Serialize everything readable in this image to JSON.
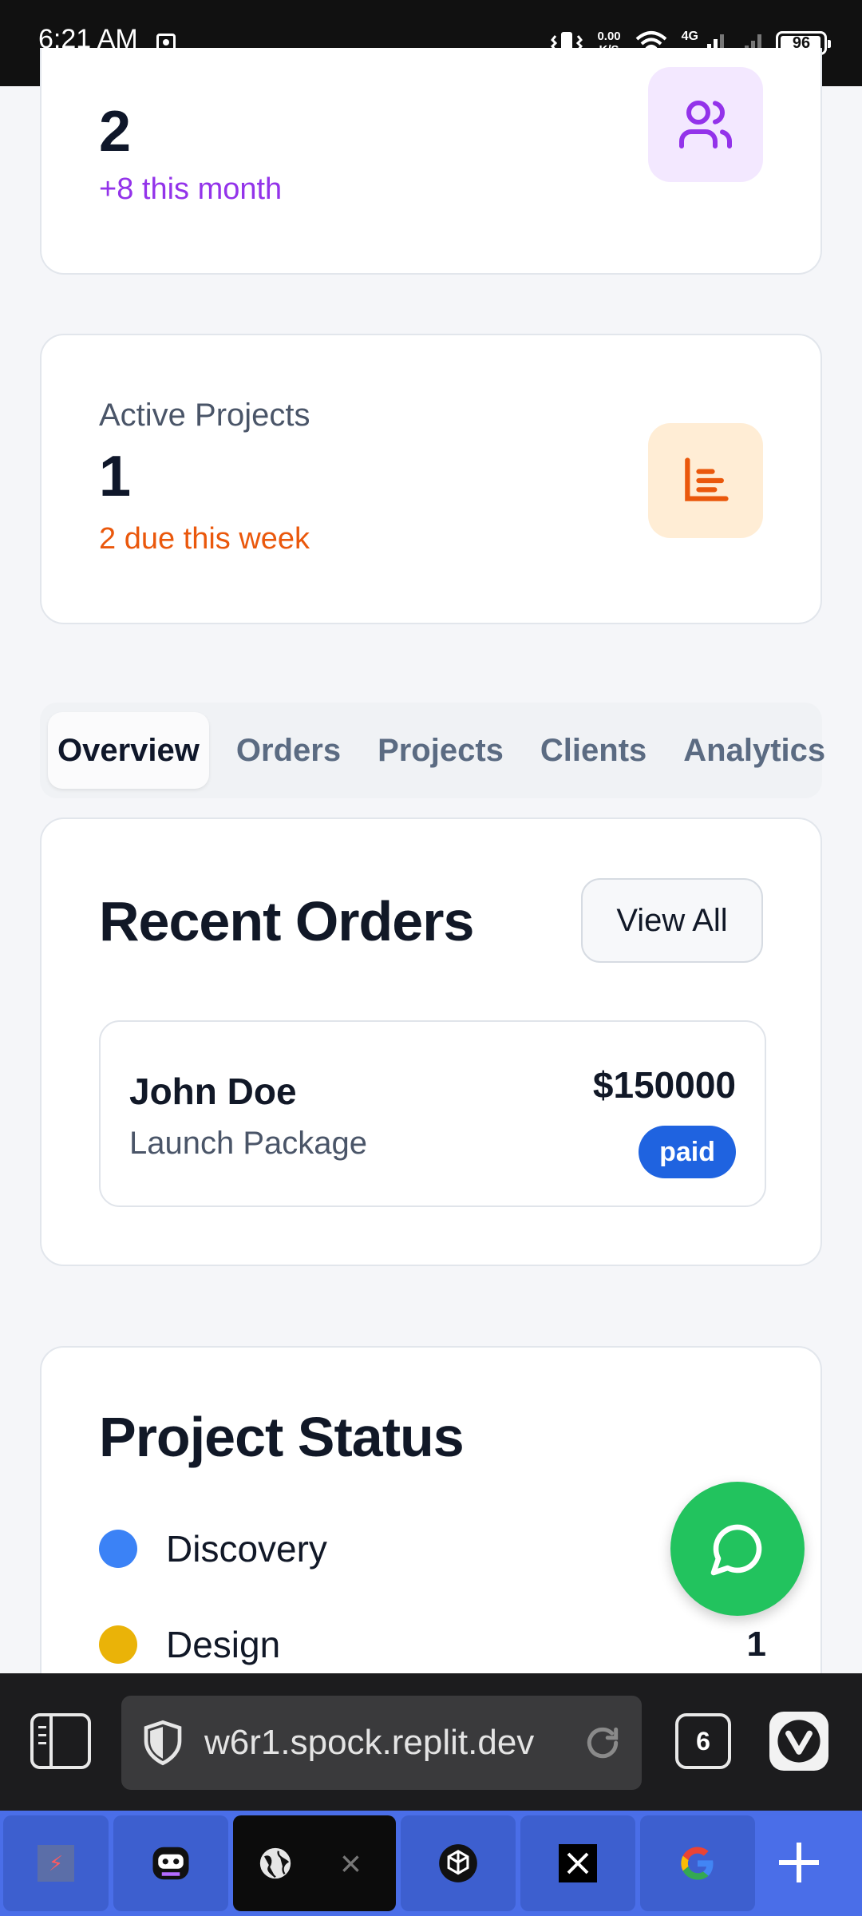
{
  "status_bar": {
    "time": "6:21 AM",
    "speed_value": "0.00",
    "speed_unit": "K/S",
    "network": "4G",
    "battery": "96"
  },
  "stats": [
    {
      "value": "2",
      "sub": "+8 this month",
      "icon": "users-icon",
      "sub_color": "#9333ea",
      "icon_bg": "#f3e8ff"
    },
    {
      "label": "Active Projects",
      "value": "1",
      "sub": "2 due this week",
      "icon": "project-list-icon",
      "sub_color": "#ea580c",
      "icon_bg": "#ffedd5"
    }
  ],
  "tabs": [
    "Overview",
    "Orders",
    "Projects",
    "Clients",
    "Analytics"
  ],
  "active_tab": "Overview",
  "recent_orders": {
    "title": "Recent Orders",
    "view_all": "View All",
    "orders": [
      {
        "customer": "John Doe",
        "package": "Launch Package",
        "amount": "$150000",
        "status": "paid"
      }
    ]
  },
  "project_status": {
    "title": "Project Status",
    "items": [
      {
        "name": "Discovery",
        "count": "",
        "color": "#3b82f6"
      },
      {
        "name": "Design",
        "count": "1",
        "color": "#eab308"
      }
    ]
  },
  "fab": {
    "icon": "chat-bubble-icon",
    "color": "#22c35e"
  },
  "browser": {
    "url": "w6r1.spock.replit.dev",
    "tab_count": "6",
    "accent": "#4a6ee8"
  },
  "open_tabs": [
    {
      "icon": "replit-icon"
    },
    {
      "icon": "bot-icon"
    },
    {
      "icon": "globe-icon",
      "active": true
    },
    {
      "icon": "chatgpt-icon"
    },
    {
      "icon": "x-logo-icon"
    },
    {
      "icon": "google-icon"
    }
  ]
}
